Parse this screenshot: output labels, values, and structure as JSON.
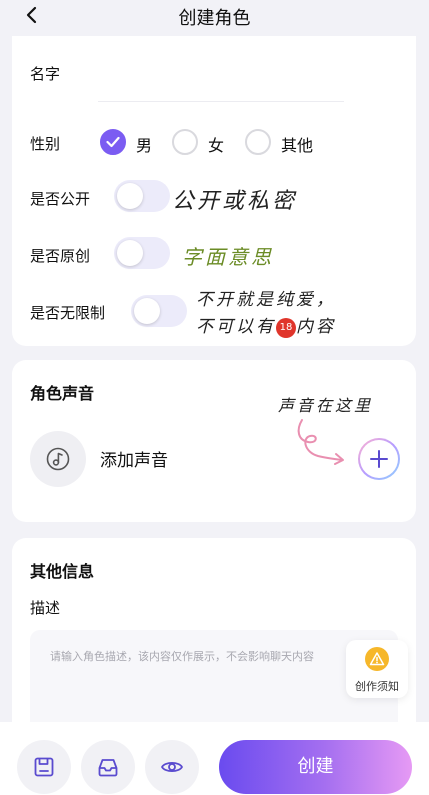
{
  "header": {
    "title": "创建角色"
  },
  "basic": {
    "name_label": "名字",
    "gender_label": "性别",
    "gender_options": [
      "男",
      "女",
      "其他"
    ],
    "gender_selected": "男",
    "public_label": "是否公开",
    "original_label": "是否原创",
    "unlimited_label": "是否无限制"
  },
  "toggles": {
    "public_on": false,
    "original_on": false,
    "unlimited_on": false
  },
  "annotations": {
    "public_note": "公开或私密",
    "original_note": "字面意思",
    "unlimited_note_line1": "不开就是纯爱，",
    "unlimited_note_line2_prefix": "不可以有",
    "unlimited_badge": "18",
    "unlimited_note_line2_suffix": "内容",
    "voice_note": "声音在这里"
  },
  "voice": {
    "section_title": "角色声音",
    "add_label": "添加声音"
  },
  "other": {
    "section_title": "其他信息",
    "desc_label": "描述",
    "desc_placeholder": "请输入角色描述，该内容仅作展示，不会影响聊天内容",
    "tips_label": "创作须知"
  },
  "footer": {
    "create_label": "创建"
  },
  "colors": {
    "accent": "#7b5cf2",
    "toggle_off": "#ecebfa",
    "annotation_green": "#6b8c26",
    "warning": "#f6b72a"
  }
}
